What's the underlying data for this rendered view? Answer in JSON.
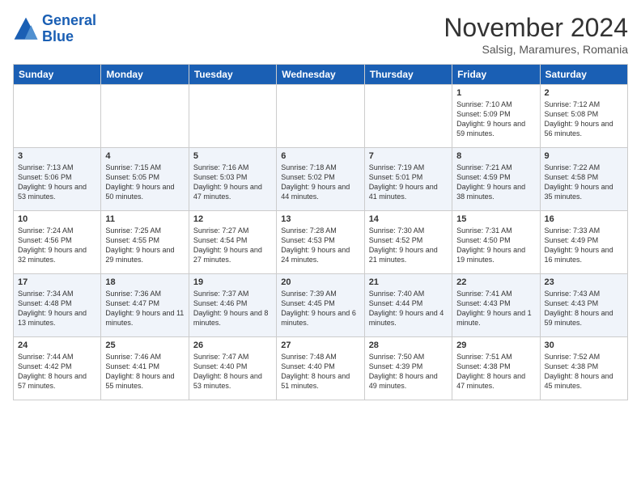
{
  "logo": {
    "line1": "General",
    "line2": "Blue"
  },
  "title": "November 2024",
  "subtitle": "Salsig, Maramures, Romania",
  "weekdays": [
    "Sunday",
    "Monday",
    "Tuesday",
    "Wednesday",
    "Thursday",
    "Friday",
    "Saturday"
  ],
  "weeks": [
    [
      {
        "day": "",
        "info": ""
      },
      {
        "day": "",
        "info": ""
      },
      {
        "day": "",
        "info": ""
      },
      {
        "day": "",
        "info": ""
      },
      {
        "day": "",
        "info": ""
      },
      {
        "day": "1",
        "info": "Sunrise: 7:10 AM\nSunset: 5:09 PM\nDaylight: 9 hours and 59 minutes."
      },
      {
        "day": "2",
        "info": "Sunrise: 7:12 AM\nSunset: 5:08 PM\nDaylight: 9 hours and 56 minutes."
      }
    ],
    [
      {
        "day": "3",
        "info": "Sunrise: 7:13 AM\nSunset: 5:06 PM\nDaylight: 9 hours and 53 minutes."
      },
      {
        "day": "4",
        "info": "Sunrise: 7:15 AM\nSunset: 5:05 PM\nDaylight: 9 hours and 50 minutes."
      },
      {
        "day": "5",
        "info": "Sunrise: 7:16 AM\nSunset: 5:03 PM\nDaylight: 9 hours and 47 minutes."
      },
      {
        "day": "6",
        "info": "Sunrise: 7:18 AM\nSunset: 5:02 PM\nDaylight: 9 hours and 44 minutes."
      },
      {
        "day": "7",
        "info": "Sunrise: 7:19 AM\nSunset: 5:01 PM\nDaylight: 9 hours and 41 minutes."
      },
      {
        "day": "8",
        "info": "Sunrise: 7:21 AM\nSunset: 4:59 PM\nDaylight: 9 hours and 38 minutes."
      },
      {
        "day": "9",
        "info": "Sunrise: 7:22 AM\nSunset: 4:58 PM\nDaylight: 9 hours and 35 minutes."
      }
    ],
    [
      {
        "day": "10",
        "info": "Sunrise: 7:24 AM\nSunset: 4:56 PM\nDaylight: 9 hours and 32 minutes."
      },
      {
        "day": "11",
        "info": "Sunrise: 7:25 AM\nSunset: 4:55 PM\nDaylight: 9 hours and 29 minutes."
      },
      {
        "day": "12",
        "info": "Sunrise: 7:27 AM\nSunset: 4:54 PM\nDaylight: 9 hours and 27 minutes."
      },
      {
        "day": "13",
        "info": "Sunrise: 7:28 AM\nSunset: 4:53 PM\nDaylight: 9 hours and 24 minutes."
      },
      {
        "day": "14",
        "info": "Sunrise: 7:30 AM\nSunset: 4:52 PM\nDaylight: 9 hours and 21 minutes."
      },
      {
        "day": "15",
        "info": "Sunrise: 7:31 AM\nSunset: 4:50 PM\nDaylight: 9 hours and 19 minutes."
      },
      {
        "day": "16",
        "info": "Sunrise: 7:33 AM\nSunset: 4:49 PM\nDaylight: 9 hours and 16 minutes."
      }
    ],
    [
      {
        "day": "17",
        "info": "Sunrise: 7:34 AM\nSunset: 4:48 PM\nDaylight: 9 hours and 13 minutes."
      },
      {
        "day": "18",
        "info": "Sunrise: 7:36 AM\nSunset: 4:47 PM\nDaylight: 9 hours and 11 minutes."
      },
      {
        "day": "19",
        "info": "Sunrise: 7:37 AM\nSunset: 4:46 PM\nDaylight: 9 hours and 8 minutes."
      },
      {
        "day": "20",
        "info": "Sunrise: 7:39 AM\nSunset: 4:45 PM\nDaylight: 9 hours and 6 minutes."
      },
      {
        "day": "21",
        "info": "Sunrise: 7:40 AM\nSunset: 4:44 PM\nDaylight: 9 hours and 4 minutes."
      },
      {
        "day": "22",
        "info": "Sunrise: 7:41 AM\nSunset: 4:43 PM\nDaylight: 9 hours and 1 minute."
      },
      {
        "day": "23",
        "info": "Sunrise: 7:43 AM\nSunset: 4:43 PM\nDaylight: 8 hours and 59 minutes."
      }
    ],
    [
      {
        "day": "24",
        "info": "Sunrise: 7:44 AM\nSunset: 4:42 PM\nDaylight: 8 hours and 57 minutes."
      },
      {
        "day": "25",
        "info": "Sunrise: 7:46 AM\nSunset: 4:41 PM\nDaylight: 8 hours and 55 minutes."
      },
      {
        "day": "26",
        "info": "Sunrise: 7:47 AM\nSunset: 4:40 PM\nDaylight: 8 hours and 53 minutes."
      },
      {
        "day": "27",
        "info": "Sunrise: 7:48 AM\nSunset: 4:40 PM\nDaylight: 8 hours and 51 minutes."
      },
      {
        "day": "28",
        "info": "Sunrise: 7:50 AM\nSunset: 4:39 PM\nDaylight: 8 hours and 49 minutes."
      },
      {
        "day": "29",
        "info": "Sunrise: 7:51 AM\nSunset: 4:38 PM\nDaylight: 8 hours and 47 minutes."
      },
      {
        "day": "30",
        "info": "Sunrise: 7:52 AM\nSunset: 4:38 PM\nDaylight: 8 hours and 45 minutes."
      }
    ]
  ]
}
